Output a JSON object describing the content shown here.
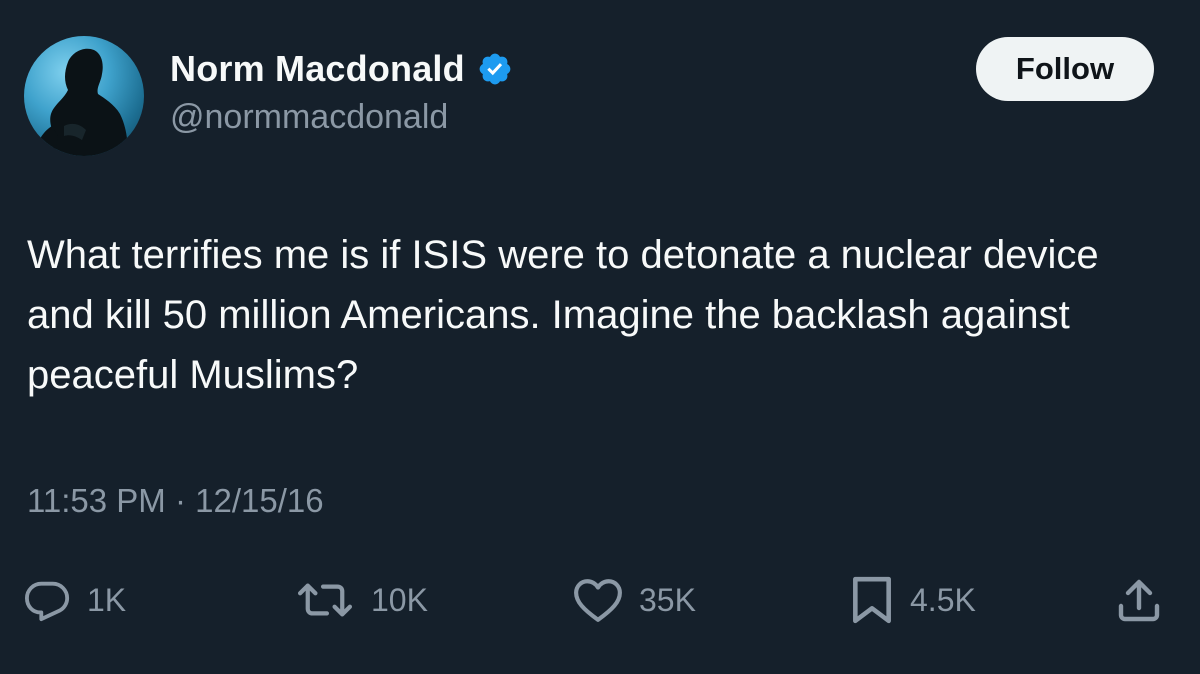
{
  "author": {
    "display_name": "Norm Macdonald",
    "handle": "@normmacdonald",
    "verified": true
  },
  "follow_button": {
    "label": "Follow"
  },
  "tweet": {
    "text": "What terrifies me is if ISIS were to detonate a nuclear device and kill 50 million Americans. Imagine the backlash against peaceful Muslims?",
    "time": "11:53 PM",
    "separator": "·",
    "date": "12/15/16"
  },
  "actions": {
    "replies": "1K",
    "retweets": "10K",
    "likes": "35K",
    "bookmarks": "4.5K"
  },
  "icons": {
    "reply": "reply-icon",
    "retweet": "retweet-icon",
    "like": "heart-icon",
    "bookmark": "bookmark-icon",
    "share": "share-icon",
    "verified": "verified-badge-icon"
  },
  "colors": {
    "background": "#15202b",
    "text": "#f7f9f9",
    "secondary_text": "#8b98a5",
    "verified_blue": "#1d9bf0",
    "follow_bg": "#eff3f4"
  }
}
